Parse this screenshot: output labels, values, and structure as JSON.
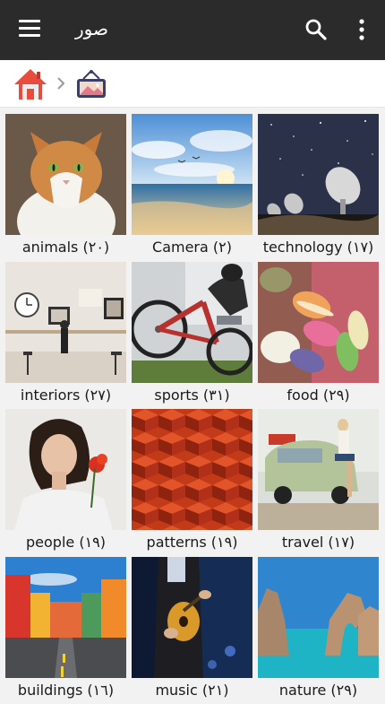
{
  "app_bar": {
    "title": "صور",
    "menu_icon": "hamburger-menu-icon",
    "search_icon": "search-icon",
    "more_icon": "more-vertical-icon"
  },
  "breadcrumb": {
    "home_icon": "home-icon",
    "separator_icon": "chevron-right-icon",
    "current_icon": "pictures-folder-icon"
  },
  "folders": [
    {
      "label": "animals (٢٠)"
    },
    {
      "label": "Camera (٢)"
    },
    {
      "label": "technology (١٧)"
    },
    {
      "label": "interiors (٢٧)"
    },
    {
      "label": "sports (٣١)"
    },
    {
      "label": "food (٢٩)"
    },
    {
      "label": "people (١٩)"
    },
    {
      "label": "patterns (١٩)"
    },
    {
      "label": "travel (١٧)"
    },
    {
      "label": "buildings (١٦)"
    },
    {
      "label": "music (٢١)"
    },
    {
      "label": "nature (٢٩)"
    }
  ]
}
